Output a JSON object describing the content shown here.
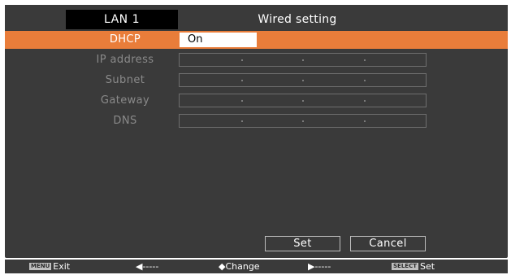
{
  "header": {
    "tab_label": "LAN 1",
    "title": "Wired setting"
  },
  "rows": [
    {
      "label": "DHCP",
      "value": "On",
      "active": true
    },
    {
      "label": "IP address",
      "value": ". . .",
      "active": false
    },
    {
      "label": "Subnet",
      "value": ". . .",
      "active": false
    },
    {
      "label": "Gateway",
      "value": ". . .",
      "active": false
    },
    {
      "label": "DNS",
      "value": ". . .",
      "active": false
    }
  ],
  "buttons": {
    "set": "Set",
    "cancel": "Cancel"
  },
  "help_bar": {
    "menu_key": "MENU",
    "exit": "Exit",
    "left": "◀-----",
    "change": "◆Change",
    "right": "▶-----",
    "select_key": "SELECT",
    "set": "Set"
  },
  "colors": {
    "highlight": "#e97d3a",
    "background": "#3a3a3a",
    "tab": "#000000",
    "disabled_text": "#8a8a8a"
  }
}
